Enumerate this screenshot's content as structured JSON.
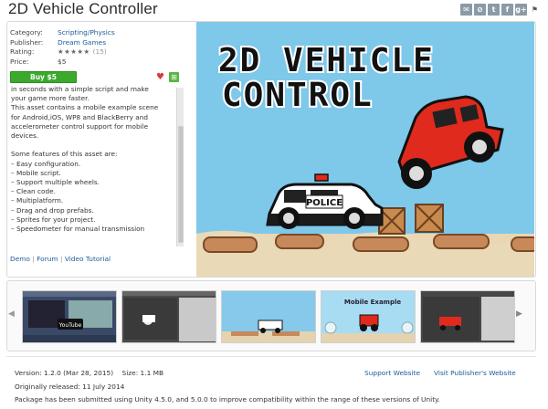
{
  "header": {
    "title": "2D Vehicle Controller",
    "share_icons": [
      "email-icon",
      "embed-icon",
      "twitter-icon",
      "facebook-icon",
      "googleplus-icon",
      "flag-icon"
    ],
    "share_glyphs": [
      "✉",
      "⊘",
      "t",
      "f",
      "g+",
      "⚑"
    ]
  },
  "meta": {
    "category_label": "Category:",
    "category_value": "Scripting/Physics",
    "publisher_label": "Publisher:",
    "publisher_value": "Dream Games",
    "rating_label": "Rating:",
    "rating_stars": "★★★★★",
    "rating_count": "(15)",
    "price_label": "Price:",
    "price_value": "$5"
  },
  "actions": {
    "buy_label": "Buy $5",
    "wishlist_glyph": "♥",
    "add_glyph": "⊞"
  },
  "description": {
    "cut_line": "...",
    "text": "in seconds with a simple script and make\nyour game more faster.\nThis asset contains a mobile example scene\nfor Android,iOS, WP8 and BlackBerry and\naccelerometer control support for mobile\ndevices.\n\nSome features of this asset are:\n– Easy configuration.\n– Mobile script.\n– Support multiple wheels.\n– Clean code.\n– Multiplatform.\n– Drag and drop prefabs.\n– Sprites for your project.\n– Speedometer for manual transmission"
  },
  "links": {
    "demo": "Demo",
    "forum": "Forum",
    "video": "Video Tutorial",
    "sep": "|"
  },
  "hero": {
    "line1": "2D VEHICLE",
    "line2": "CONTROL",
    "police_label": "POLICE"
  },
  "thumbnails": {
    "prev_glyph": "◀",
    "next_glyph": "▶",
    "youtube_label": "YouTube",
    "mobile_label": "Mobile Example"
  },
  "footer": {
    "version": "Version: 1.2.0 (Mar 28, 2015)    Size: 1.1 MB",
    "released": "Originally released: 11 July 2014",
    "package_note": "Package has been submitted using Unity 4.5.0, and 5.0.0 to improve compatibility within the range of these versions of Unity.",
    "support_link": "Support Website",
    "publisher_link": "Visit Publisher's Website"
  },
  "colors": {
    "buy_green": "#3aa92c",
    "link_blue": "#1a5a9a",
    "sky": "#7ec8ea",
    "car_red": "#e02a1d"
  }
}
